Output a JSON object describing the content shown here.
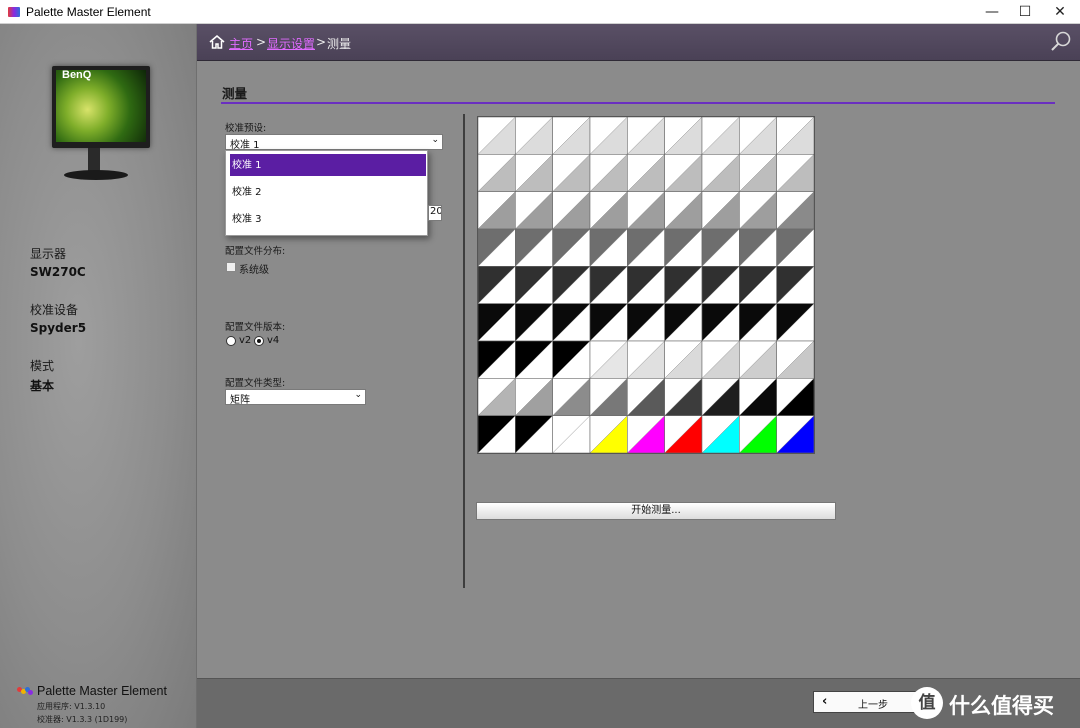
{
  "window": {
    "title": "Palette Master Element",
    "min_glyph": "—",
    "max_glyph": "☐",
    "close_glyph": "✕"
  },
  "sidebar": {
    "monitor_brand": "BenQ",
    "display_label": "显示器",
    "display_value": "SW270C",
    "device_label": "校准设备",
    "device_value": "Spyder5",
    "mode_label": "模式",
    "mode_value": "基本",
    "app_name": "Palette Master Element",
    "app_version": "应用程序:  V1.3.10",
    "calibrator_version": "校准器:  V1.3.3 (1D199)"
  },
  "breadcrumb": {
    "home": "主页",
    "sep1": ">",
    "display_settings": "显示设置",
    "sep2": ">",
    "current": "测量"
  },
  "main": {
    "section_title": "测量",
    "preset_label": "校准预设:",
    "preset_value": "校准 1",
    "preset_options": [
      "校准 1",
      "校准 2",
      "校准 3"
    ],
    "partial_input_value": "20",
    "distribution_label": "配置文件分布:",
    "system_level_label": "系统级",
    "system_level_checked": false,
    "version_label": "配置文件版本:",
    "version_v2": "v2",
    "version_v4": "v4",
    "version_selected": "v4",
    "type_label": "配置文件类型:",
    "type_value": "矩阵",
    "measure_button": "开始测量..."
  },
  "patch_grid": {
    "rows": 9,
    "cols": 9,
    "split": "diagonal",
    "cells": [
      [
        [
          "#ffffff",
          "#dcdcdc"
        ],
        [
          "#ffffff",
          "#dcdcdc"
        ],
        [
          "#ffffff",
          "#dcdcdc"
        ],
        [
          "#ffffff",
          "#dcdcdc"
        ],
        [
          "#ffffff",
          "#dcdcdc"
        ],
        [
          "#ffffff",
          "#dcdcdc"
        ],
        [
          "#ffffff",
          "#dcdcdc"
        ],
        [
          "#ffffff",
          "#dcdcdc"
        ],
        [
          "#ffffff",
          "#dcdcdc"
        ]
      ],
      [
        [
          "#ffffff",
          "#bdbdbd"
        ],
        [
          "#ffffff",
          "#bdbdbd"
        ],
        [
          "#ffffff",
          "#bdbdbd"
        ],
        [
          "#ffffff",
          "#bdbdbd"
        ],
        [
          "#ffffff",
          "#bdbdbd"
        ],
        [
          "#ffffff",
          "#bdbdbd"
        ],
        [
          "#ffffff",
          "#bdbdbd"
        ],
        [
          "#ffffff",
          "#bdbdbd"
        ],
        [
          "#ffffff",
          "#bdbdbd"
        ]
      ],
      [
        [
          "#ffffff",
          "#9e9e9e"
        ],
        [
          "#ffffff",
          "#9e9e9e"
        ],
        [
          "#ffffff",
          "#9e9e9e"
        ],
        [
          "#ffffff",
          "#9e9e9e"
        ],
        [
          "#ffffff",
          "#9e9e9e"
        ],
        [
          "#ffffff",
          "#9e9e9e"
        ],
        [
          "#ffffff",
          "#9e9e9e"
        ],
        [
          "#ffffff",
          "#9e9e9e"
        ],
        [
          "#ffffff",
          "#8a8a8a"
        ]
      ],
      [
        [
          "#6e6e6e",
          "#ffffff"
        ],
        [
          "#6e6e6e",
          "#ffffff"
        ],
        [
          "#6e6e6e",
          "#ffffff"
        ],
        [
          "#6e6e6e",
          "#ffffff"
        ],
        [
          "#6e6e6e",
          "#ffffff"
        ],
        [
          "#6e6e6e",
          "#ffffff"
        ],
        [
          "#6e6e6e",
          "#ffffff"
        ],
        [
          "#6e6e6e",
          "#ffffff"
        ],
        [
          "#6e6e6e",
          "#ffffff"
        ]
      ],
      [
        [
          "#303030",
          "#ffffff"
        ],
        [
          "#303030",
          "#ffffff"
        ],
        [
          "#303030",
          "#ffffff"
        ],
        [
          "#303030",
          "#ffffff"
        ],
        [
          "#303030",
          "#ffffff"
        ],
        [
          "#303030",
          "#ffffff"
        ],
        [
          "#303030",
          "#ffffff"
        ],
        [
          "#303030",
          "#ffffff"
        ],
        [
          "#303030",
          "#ffffff"
        ]
      ],
      [
        [
          "#0a0a0a",
          "#ffffff"
        ],
        [
          "#0a0a0a",
          "#ffffff"
        ],
        [
          "#0a0a0a",
          "#ffffff"
        ],
        [
          "#0a0a0a",
          "#ffffff"
        ],
        [
          "#0a0a0a",
          "#ffffff"
        ],
        [
          "#0a0a0a",
          "#ffffff"
        ],
        [
          "#0a0a0a",
          "#ffffff"
        ],
        [
          "#0a0a0a",
          "#ffffff"
        ],
        [
          "#0a0a0a",
          "#ffffff"
        ]
      ],
      [
        [
          "#000000",
          "#ffffff"
        ],
        [
          "#000000",
          "#ffffff"
        ],
        [
          "#000000",
          "#ffffff"
        ],
        [
          "#ffffff",
          "#e6e6e6"
        ],
        [
          "#ffffff",
          "#e0e0e0"
        ],
        [
          "#ffffff",
          "#dadada"
        ],
        [
          "#ffffff",
          "#d4d4d4"
        ],
        [
          "#ffffff",
          "#cecece"
        ],
        [
          "#ffffff",
          "#c8c8c8"
        ]
      ],
      [
        [
          "#ffffff",
          "#b4b4b4"
        ],
        [
          "#ffffff",
          "#a0a0a0"
        ],
        [
          "#ffffff",
          "#8c8c8c"
        ],
        [
          "#ffffff",
          "#787878"
        ],
        [
          "#ffffff",
          "#5a5a5a"
        ],
        [
          "#ffffff",
          "#3c3c3c"
        ],
        [
          "#ffffff",
          "#1e1e1e"
        ],
        [
          "#ffffff",
          "#0a0a0a"
        ],
        [
          "#ffffff",
          "#000000"
        ]
      ],
      [
        [
          "#000000",
          "#ffffff"
        ],
        [
          "#000000",
          "#ffffff"
        ],
        [
          "#ffffff",
          "#ffffff"
        ],
        [
          "#ffffff",
          "#ffff00"
        ],
        [
          "#ffffff",
          "#ff00ff"
        ],
        [
          "#ffffff",
          "#ff0000"
        ],
        [
          "#ffffff",
          "#00ffff"
        ],
        [
          "#ffffff",
          "#00ff00"
        ],
        [
          "#ffffff",
          "#0000ff"
        ]
      ]
    ]
  },
  "footer": {
    "back_button": "上一步",
    "watermark_glyph": "值",
    "watermark_text": "什么值得买"
  }
}
